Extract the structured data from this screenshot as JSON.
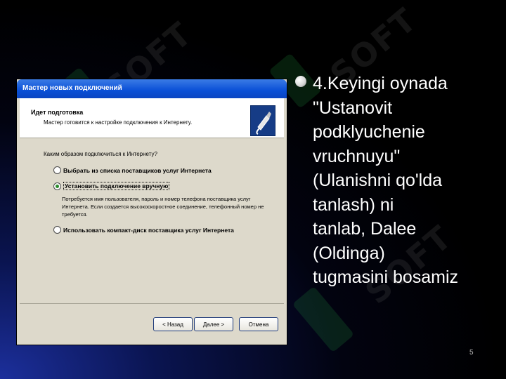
{
  "dialog": {
    "title": "Мастер новых подключений",
    "header_title": "Идет подготовка",
    "header_subtitle": "Мастер готовится к настройке подключения к Интернету.",
    "question": "Каким образом подключиться к Интернету?",
    "options": [
      {
        "label": "Выбрать из списка поставщиков услуг Интернета",
        "selected": false
      },
      {
        "label": "Установить подключение вручную",
        "selected": true
      },
      {
        "label": "Использовать компакт-диск поставщика услуг Интернета",
        "selected": false
      }
    ],
    "option2_description": "Потребуется имя пользователя, пароль и номер телефона поставщика услуг Интернета. Если создается высокоскоростное соединение, телефонный номер не требуется.",
    "buttons": {
      "back": "< Назад",
      "next": "Далее >",
      "cancel": "Отмена"
    }
  },
  "slide": {
    "bullet_text": "4.Keyingi oynada\n\"Ustanovit\npodklyuchenie\nvruchnuyu\"\n(Ulanishni qo'lda\ntanlash) ni\ntanlab, Dalee\n(Oldinga)\ntugmasini bosamiz",
    "page_number": "5",
    "watermark": "SOFT"
  },
  "colors": {
    "titlebar": "#0a4fd6",
    "dialog_bg": "#ddd9cb",
    "text": "#ffffff",
    "watermark_green": "#1f8a3a"
  }
}
